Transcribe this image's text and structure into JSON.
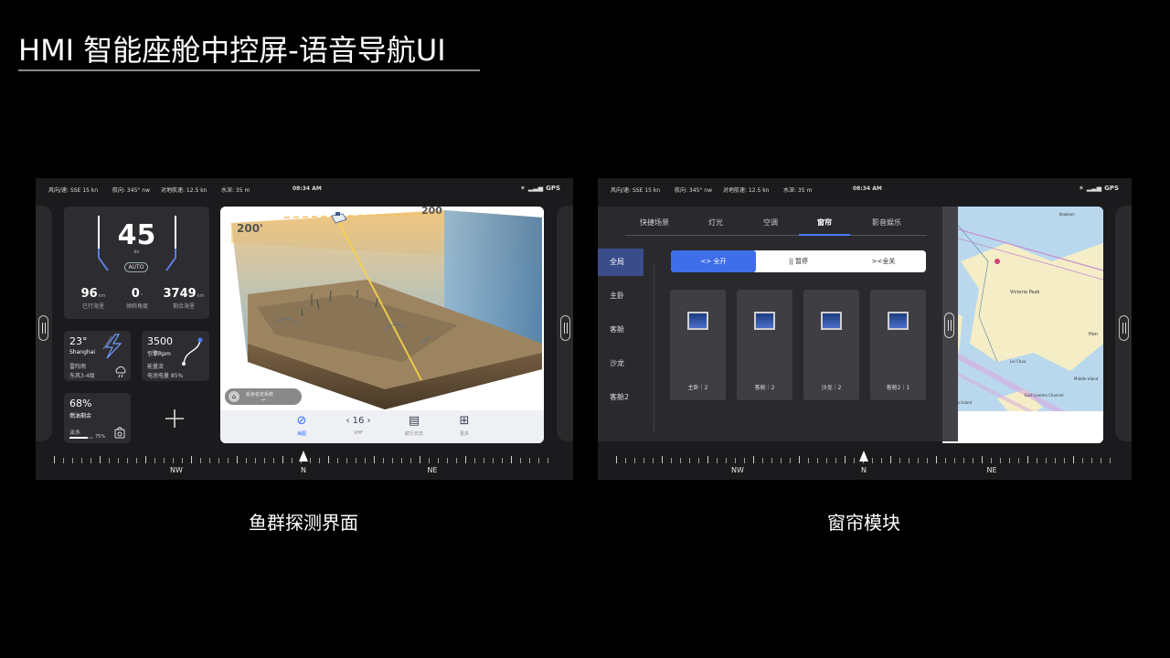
{
  "page": {
    "title": "HMI 智能座舱中控屏-语音导航UI",
    "captions": [
      "鱼群探测界面",
      "窗帘模块"
    ]
  },
  "status": {
    "wind": "风向/速: SSE 15 kn",
    "heading": "航向: 345° nw",
    "sog": "对地航速: 12.5 kn",
    "depth": "水深: 35 m",
    "time": "08:34 AM",
    "gps": "GPS"
  },
  "screen1": {
    "speed": "45",
    "speed_unit": "kn",
    "auto": "AUTO",
    "stats": [
      {
        "value": "96",
        "unit": "km",
        "label": "已行海里"
      },
      {
        "value": "0",
        "unit": "°",
        "label": "倾斜角度"
      },
      {
        "value": "3749",
        "unit": "km",
        "label": "剩余海里"
      }
    ],
    "weather": {
      "temp": "23°",
      "city": "Shanghai",
      "cond": "雷阵雨",
      "wind": "东风3-4级"
    },
    "engine": {
      "rpm": "3500",
      "rpm_label": "引擎Rpm",
      "flow": "能量流",
      "battery": "电池电量 85%"
    },
    "fuel": {
      "pct": "68%",
      "label": "燃油剩余",
      "water": "淡水",
      "water_pct": "75%"
    },
    "viz": {
      "depth_left": "200'",
      "depth_right": "200",
      "lock_label": "船身稳定系统"
    },
    "nav": {
      "map": "海图",
      "vhf": "VHF",
      "channel": "16",
      "log": "航行日志",
      "more": "更多"
    }
  },
  "screen2": {
    "tabs": [
      "快捷场景",
      "灯光",
      "空调",
      "窗帘",
      "影音娱乐"
    ],
    "active_tab": "窗帘",
    "rooms": [
      "全局",
      "主卧",
      "客舱",
      "沙龙",
      "客舱2"
    ],
    "segments": [
      "<> 全开",
      "|| 暂停",
      "><全关"
    ],
    "curtains": [
      "主卧｜2",
      "客舱｜2",
      "沙龙｜2",
      "客舱2｜1"
    ],
    "map_labels": [
      "Victoria Peak",
      "Kowloon",
      "Lei Chau",
      "Lamma Island",
      "East Lamma Channel",
      "Hon",
      "Middle Island"
    ]
  },
  "compass": {
    "labels": [
      "NW",
      "N",
      "NE"
    ]
  },
  "colors": {
    "accent": "#3f6ee9",
    "panel": "#2d2d31",
    "screen": "#1b1b1d"
  }
}
